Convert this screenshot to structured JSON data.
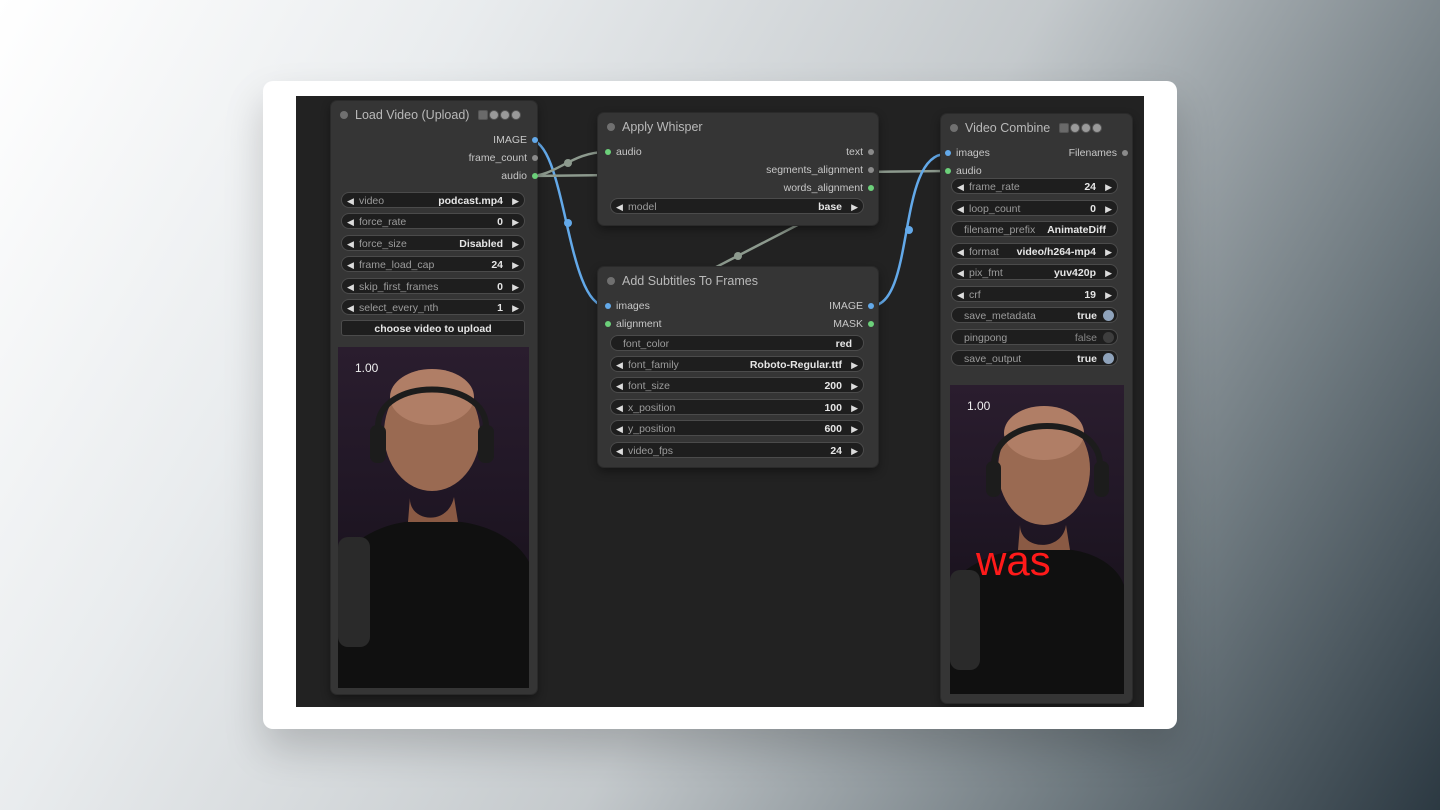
{
  "load_video": {
    "title": "Load Video (Upload)",
    "outputs": [
      "IMAGE",
      "frame_count",
      "audio"
    ],
    "widgets": [
      {
        "label": "video",
        "value": "podcast.mp4"
      },
      {
        "label": "force_rate",
        "value": "0"
      },
      {
        "label": "force_size",
        "value": "Disabled"
      },
      {
        "label": "frame_load_cap",
        "value": "24"
      },
      {
        "label": "skip_first_frames",
        "value": "0"
      },
      {
        "label": "select_every_nth",
        "value": "1"
      }
    ],
    "upload_button": "choose video to upload",
    "preview_label": "1.00"
  },
  "apply_whisper": {
    "title": "Apply Whisper",
    "inputs": [
      "audio"
    ],
    "outputs": [
      "text",
      "segments_alignment",
      "words_alignment"
    ],
    "widgets": [
      {
        "label": "model",
        "value": "base"
      }
    ]
  },
  "add_subtitles": {
    "title": "Add Subtitles To Frames",
    "inputs": [
      "images",
      "alignment"
    ],
    "outputs": [
      "IMAGE",
      "MASK"
    ],
    "widgets": [
      {
        "label": "font_color",
        "value": "red"
      },
      {
        "label": "font_family",
        "value": "Roboto-Regular.ttf"
      },
      {
        "label": "font_size",
        "value": "200"
      },
      {
        "label": "x_position",
        "value": "100"
      },
      {
        "label": "y_position",
        "value": "600"
      },
      {
        "label": "video_fps",
        "value": "24"
      }
    ]
  },
  "video_combine": {
    "title": "Video Combine",
    "inputs": [
      "images",
      "audio"
    ],
    "outputs": [
      "Filenames"
    ],
    "widgets": [
      {
        "label": "frame_rate",
        "value": "24"
      },
      {
        "label": "loop_count",
        "value": "0"
      },
      {
        "label": "filename_prefix",
        "value": "AnimateDiff"
      },
      {
        "label": "format",
        "value": "video/h264-mp4"
      },
      {
        "label": "pix_fmt",
        "value": "yuv420p"
      },
      {
        "label": "crf",
        "value": "19"
      },
      {
        "label": "save_metadata",
        "value": "true"
      },
      {
        "label": "pingpong",
        "value": "false"
      },
      {
        "label": "save_output",
        "value": "true"
      }
    ],
    "preview_label": "1.00",
    "subtitle_text": "was"
  },
  "colors": {
    "canvas": "#222222",
    "node": "#353535",
    "image_link": "#63a9e9",
    "audio_link": "#6cd07a",
    "generic_link": "#8d9a8e",
    "subtitle": "#ff1a1a"
  }
}
